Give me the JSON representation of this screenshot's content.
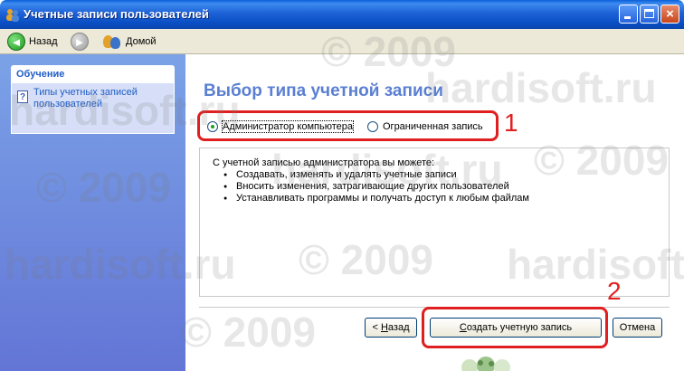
{
  "window": {
    "title": "Учетные записи пользователей",
    "controls": {
      "close_glyph": "×"
    }
  },
  "toolbar": {
    "back_label": "Назад",
    "back_glyph": "◄",
    "forward_glyph": "►",
    "home_label": "Домой"
  },
  "sidebar": {
    "section_title": "Обучение",
    "help_glyph": "?",
    "link": "Типы учетных записей пользователей"
  },
  "main": {
    "heading": "Выбор типа учетной записи",
    "options": [
      {
        "label": "Администратор компьютера",
        "selected": true
      },
      {
        "label": "Ограниченная запись",
        "selected": false
      }
    ],
    "info_intro": "С учетной записью администратора вы можете:",
    "info_items": [
      "Создавать, изменять и удалять учетные записи",
      "Вносить изменения, затрагивающие других пользователей",
      "Устанавливать программы и получать доступ к любым файлам"
    ],
    "buttons": {
      "back_prefix": "< ",
      "back_access": "Н",
      "back_rest": "азад",
      "create_access": "С",
      "create_rest": "оздать учетную запись",
      "cancel": "Отмена"
    }
  },
  "annotations": {
    "marker1": "1",
    "marker2": "2",
    "color": "#e02020"
  },
  "watermark": {
    "texts": [
      "hardisoft.ru",
      "© 2009",
      "hardisoft.ru",
      "© 2009",
      "hardisoft.ru",
      "© 2009",
      "hardisoft.ru",
      "© 2009",
      "hardisoft.ru",
      "© 2009"
    ]
  },
  "colors": {
    "titlebar": "#0a4ec4",
    "sidebar": "#6f8fde",
    "heading": "#5a7fd2",
    "link": "#215dc6"
  }
}
